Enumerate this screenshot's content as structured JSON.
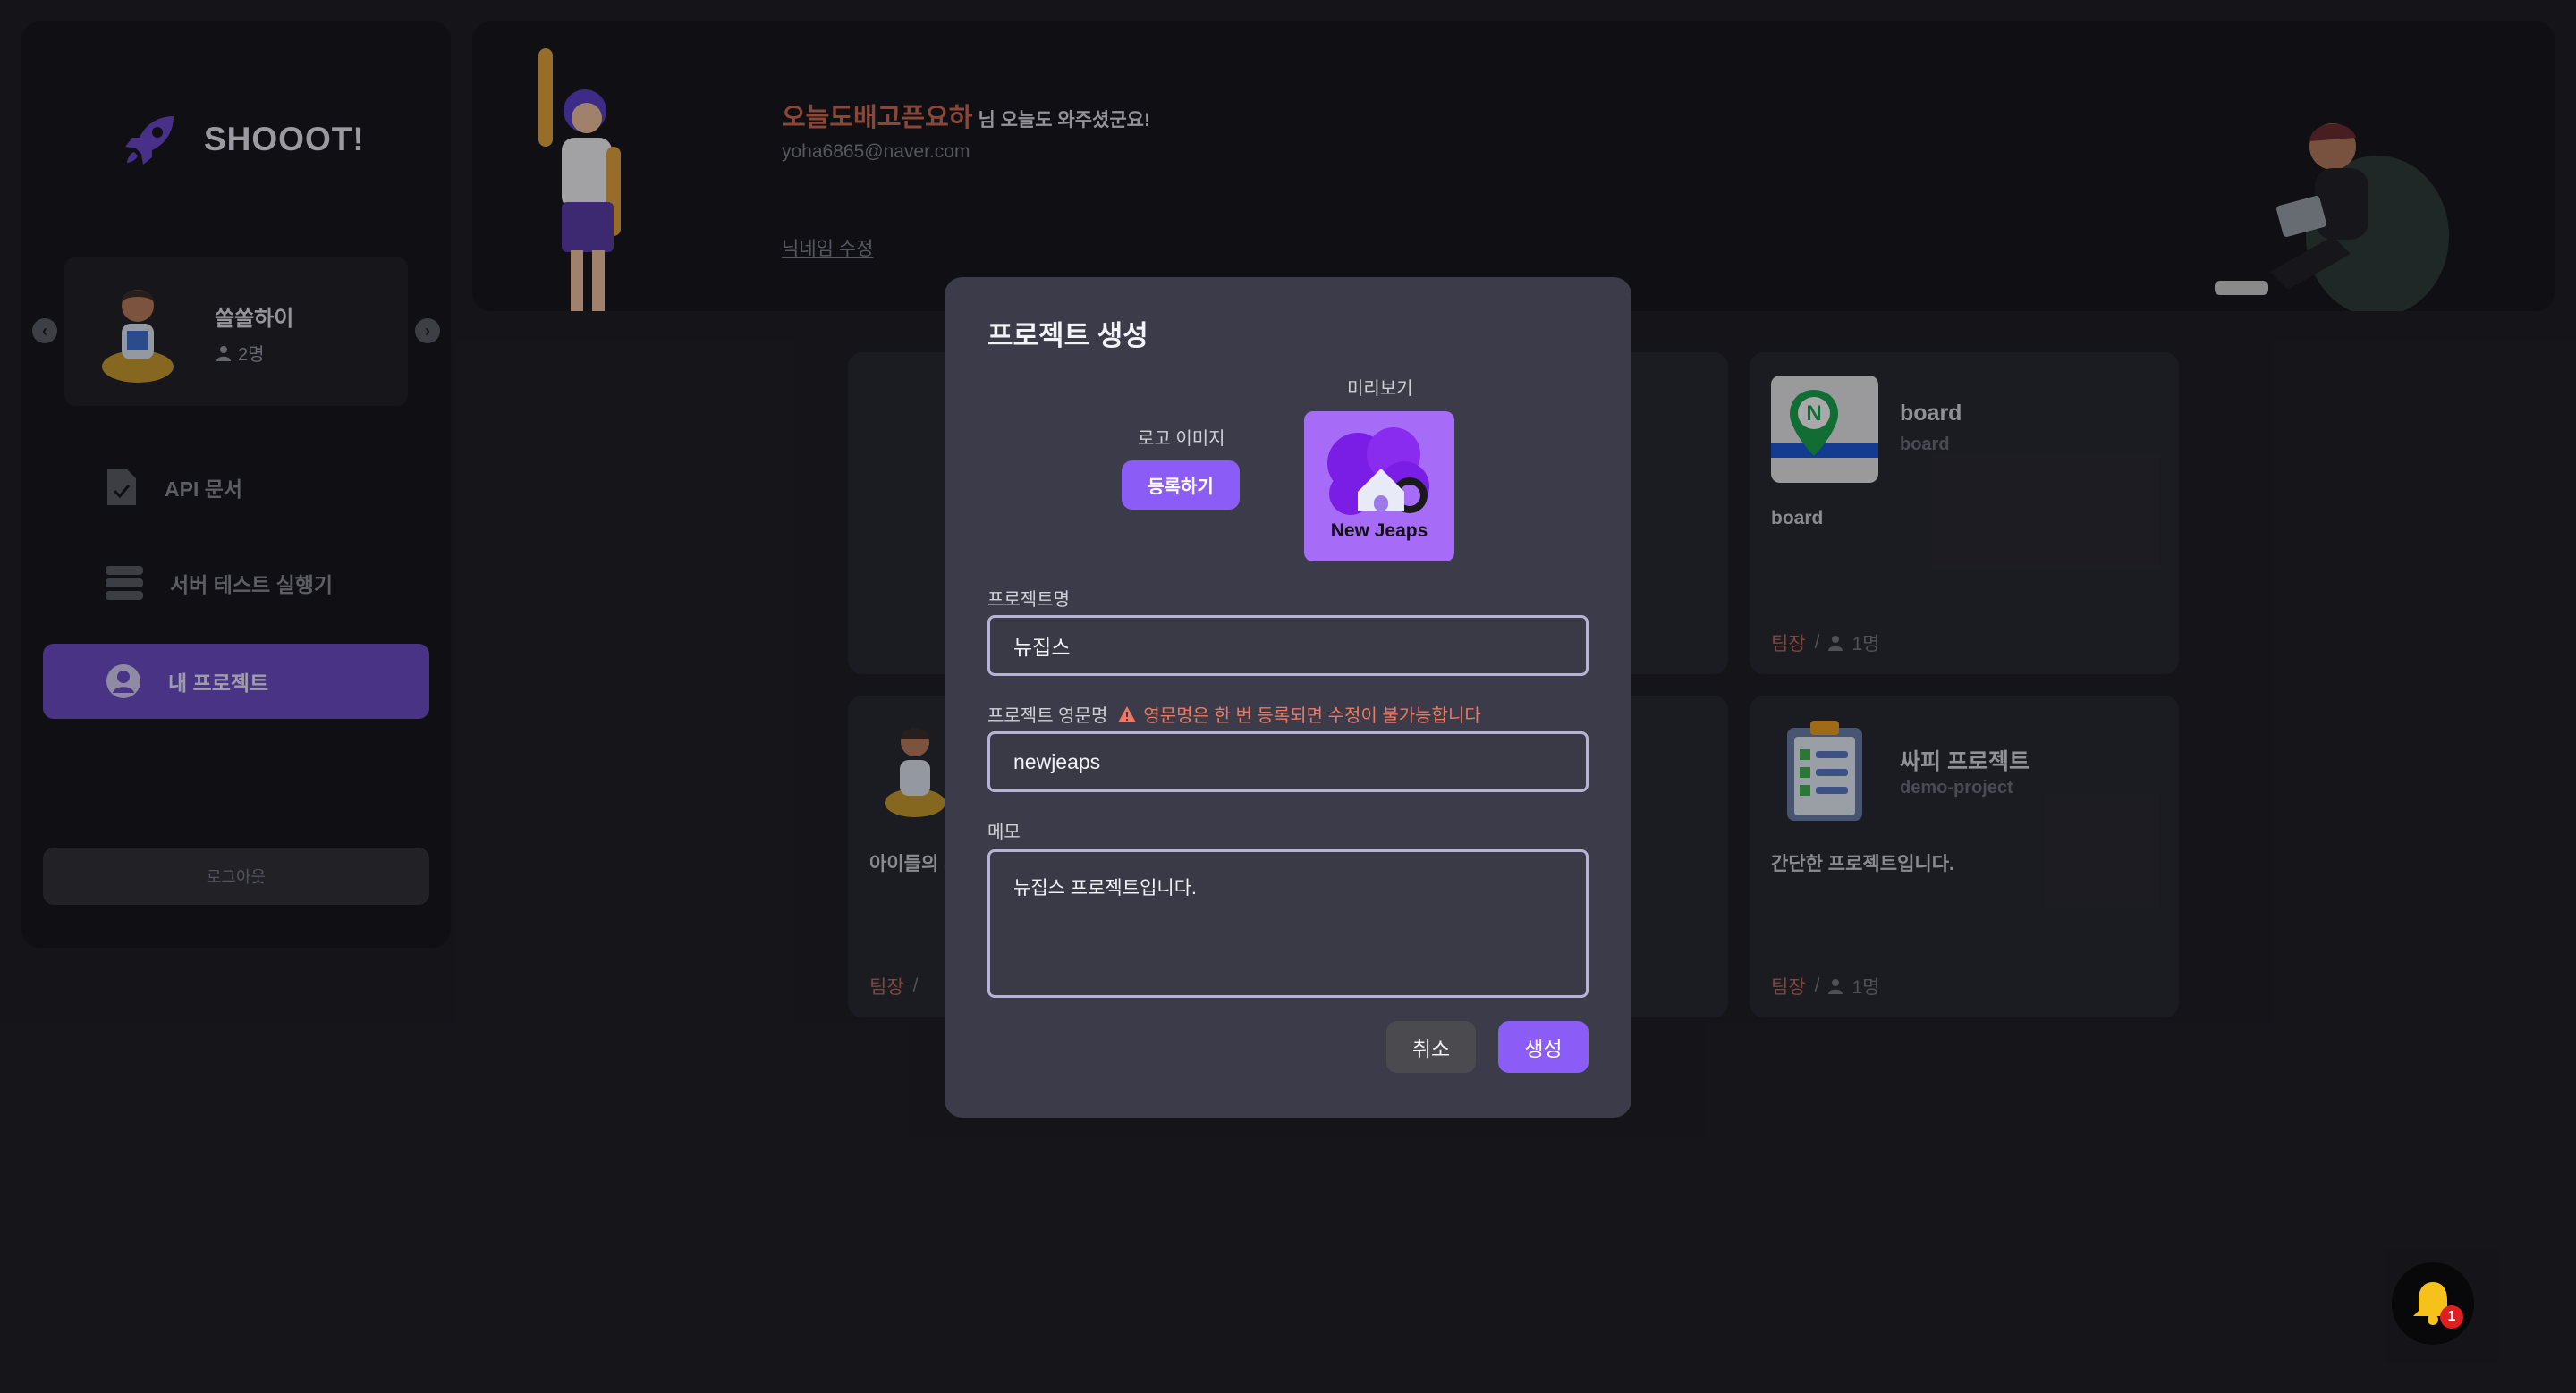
{
  "sidebar": {
    "app_name": "SHOOOT!",
    "team": {
      "name": "쏠쏠하이",
      "member_count": "2명"
    },
    "nav": [
      {
        "label": "API 문서",
        "icon": "document-check-icon"
      },
      {
        "label": "서버 테스트 실행기",
        "icon": "server-icon"
      },
      {
        "label": "내 프로젝트",
        "icon": "user-circle-icon",
        "active": true
      }
    ],
    "logout_label": "로그아웃"
  },
  "header": {
    "nickname": "오늘도배고픈요하",
    "greeting_suffix": "님 오늘도 와주셨군요!",
    "email": "yoha6865@naver.com",
    "edit_nickname_label": "닉네임 수정"
  },
  "projects": [
    {
      "title": "board",
      "subtitle": "board",
      "description": "board",
      "role": "팀장",
      "members": "1명"
    },
    {
      "title": "",
      "subtitle": "",
      "description": "아이들의 지",
      "role": "팀장",
      "members": ""
    },
    {
      "title": "싸피 프로젝트",
      "subtitle": "demo-project",
      "description": "간단한 프로젝트입니다.",
      "role": "팀장",
      "members": "1명"
    }
  ],
  "modal": {
    "title": "프로젝트 생성",
    "preview_label": "미리보기",
    "logo_label": "로고 이미지",
    "register_button": "등록하기",
    "preview_logo_text": "New Jeaps",
    "name_label": "프로젝트명",
    "name_value": "뉴집스",
    "english_name_label": "프로젝트 영문명",
    "english_name_warning": "영문명은 한 번 등록되면 수정이 불가능합니다",
    "english_name_value": "newjeaps",
    "memo_label": "메모",
    "memo_value": "뉴집스 프로젝트입니다.",
    "cancel_button": "취소",
    "create_button": "생성"
  },
  "notification": {
    "count": "1"
  },
  "colors": {
    "accent": "#8b5cf6",
    "active_nav": "#6c4bc4",
    "leader": "#c2674f",
    "warning": "#f07862"
  }
}
